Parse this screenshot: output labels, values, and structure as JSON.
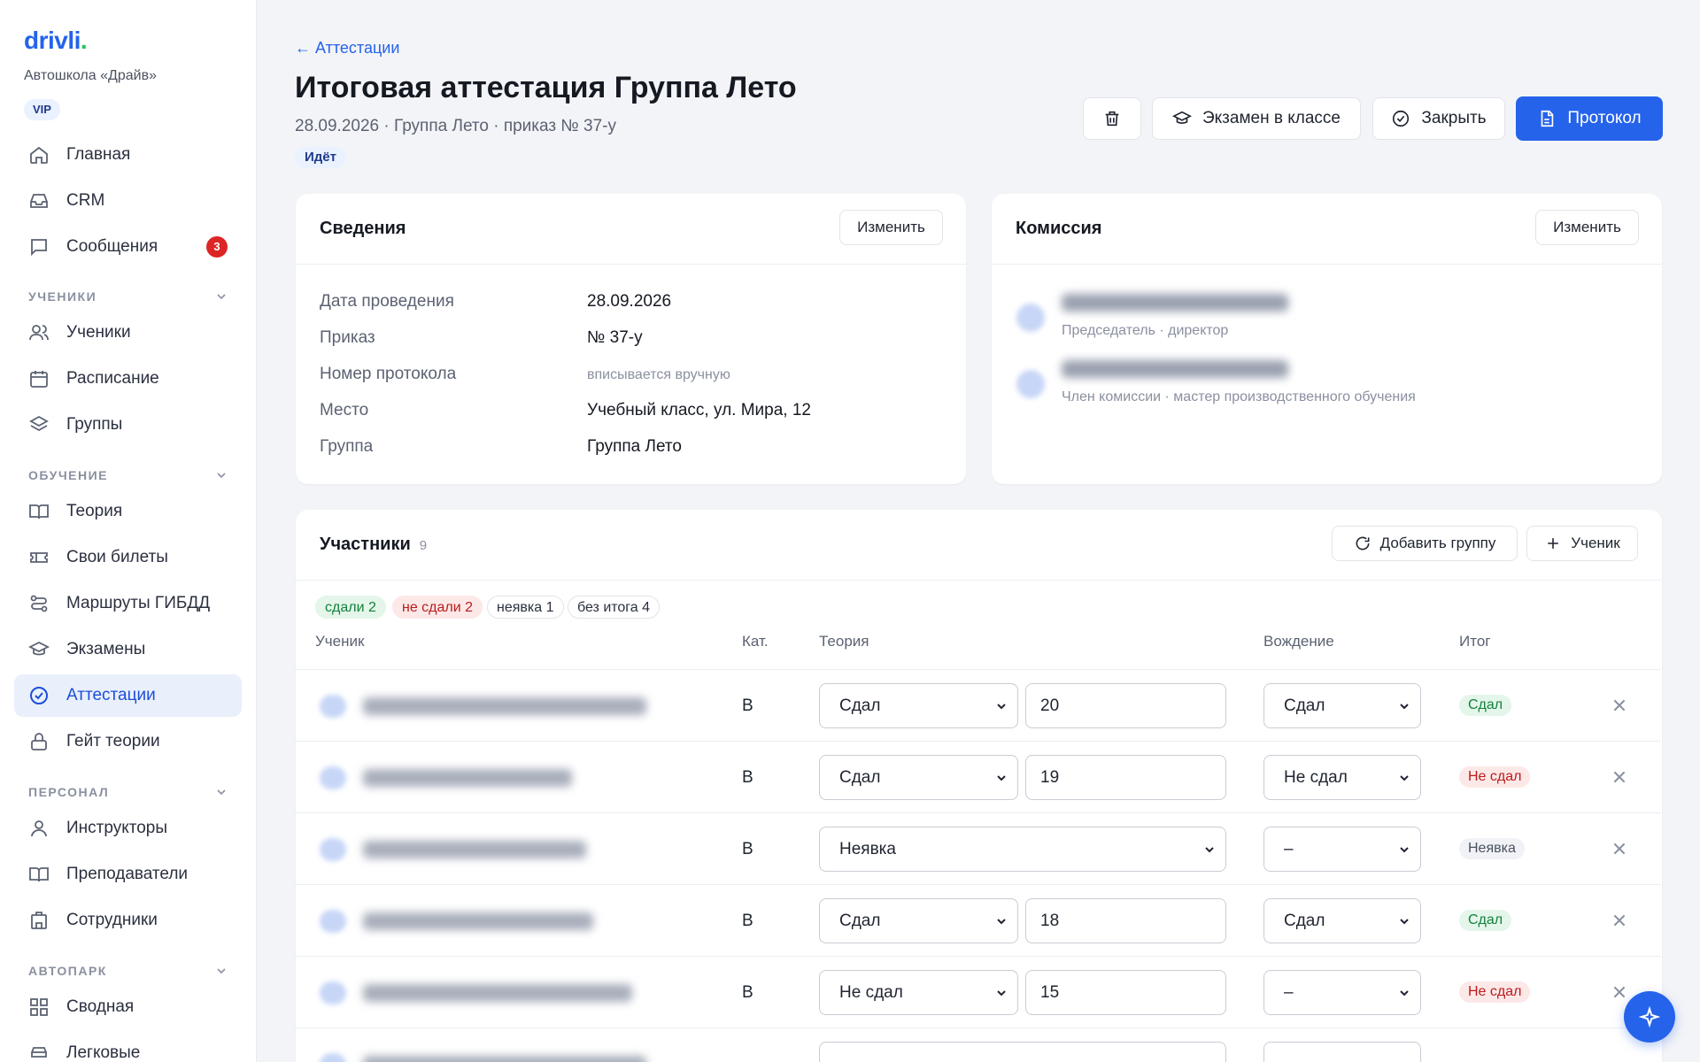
{
  "app": {
    "logo": "drivli",
    "logo_dot": ".",
    "school": "Автошкола «Драйв»",
    "plan": "VIP"
  },
  "sidebar": {
    "top": [
      {
        "label": "Главная",
        "icon": "home-icon"
      },
      {
        "label": "CRM",
        "icon": "inbox-icon"
      },
      {
        "label": "Сообщения",
        "icon": "chat-icon",
        "badge": "3"
      }
    ],
    "sections": [
      {
        "title": "УЧЕНИКИ",
        "items": [
          "Ученики",
          "Расписание",
          "Группы"
        ]
      },
      {
        "title": "ОБУЧЕНИЕ",
        "items": [
          "Теория",
          "Свои билеты",
          "Маршруты ГИБДД",
          "Экзамены",
          "Аттестации",
          "Гейт теории"
        ]
      },
      {
        "title": "ПЕРСОНАЛ",
        "items": [
          "Инструкторы",
          "Преподаватели",
          "Сотрудники"
        ]
      },
      {
        "title": "АВТОПАРК",
        "items": [
          "Сводная",
          "Легковые"
        ]
      }
    ],
    "active": "Аттестации"
  },
  "header": {
    "back": "← Аттестации",
    "title": "Итоговая аттестация Группа Лето",
    "subtitle": "28.09.2026 · Группа Лето · приказ № 37-у",
    "status": "Идёт",
    "actions": {
      "exam": "Экзамен в классе",
      "close": "Закрыть",
      "protocol": "Протокол"
    }
  },
  "info": {
    "title": "Сведения",
    "edit": "Изменить",
    "rows": [
      {
        "label": "Дата проведения",
        "value": "28.09.2026"
      },
      {
        "label": "Приказ",
        "value": "№ 37-у"
      },
      {
        "label": "Номер протокола",
        "value": "вписывается вручную"
      },
      {
        "label": "Место",
        "value": "Учебный класс, ул. Мира, 12"
      },
      {
        "label": "Группа",
        "value": "Группа Лето"
      }
    ]
  },
  "commission": {
    "title": "Комиссия",
    "edit": "Изменить",
    "members": [
      {
        "role": "Председатель · директор"
      },
      {
        "role": "Член комиссии · мастер производственного обучения"
      }
    ]
  },
  "participants": {
    "title": "Участники",
    "count": "9",
    "add_group": "Добавить группу",
    "add_student": "Ученик",
    "filters": {
      "passed": "сдали 2",
      "failed": "не сдали 2",
      "absent": "неявка 1",
      "no_result": "без итога 4"
    },
    "columns": {
      "student": "Ученик",
      "category": "Кат.",
      "theory": "Теория",
      "driving": "Вождение",
      "result": "Итог"
    },
    "rows": [
      {
        "category": "B",
        "theory": "Сдал",
        "score": "20",
        "driving": "Сдал",
        "result": "Сдал",
        "status": "ok"
      },
      {
        "category": "B",
        "theory": "Сдал",
        "score": "19",
        "driving": "Не сдал",
        "result": "Не сдал",
        "status": "bad"
      },
      {
        "category": "B",
        "theory": "Неявка",
        "score": "",
        "driving": "–",
        "result": "Неявка",
        "status": "neutral"
      },
      {
        "category": "B",
        "theory": "Сдал",
        "score": "18",
        "driving": "Сдал",
        "result": "Сдал",
        "status": "ok"
      },
      {
        "category": "B",
        "theory": "Не сдал",
        "score": "15",
        "driving": "–",
        "result": "Не сдал",
        "status": "bad"
      }
    ]
  },
  "colors": {
    "accent": "#2563eb",
    "pass": "#15803d",
    "fail": "#b91c1c"
  }
}
